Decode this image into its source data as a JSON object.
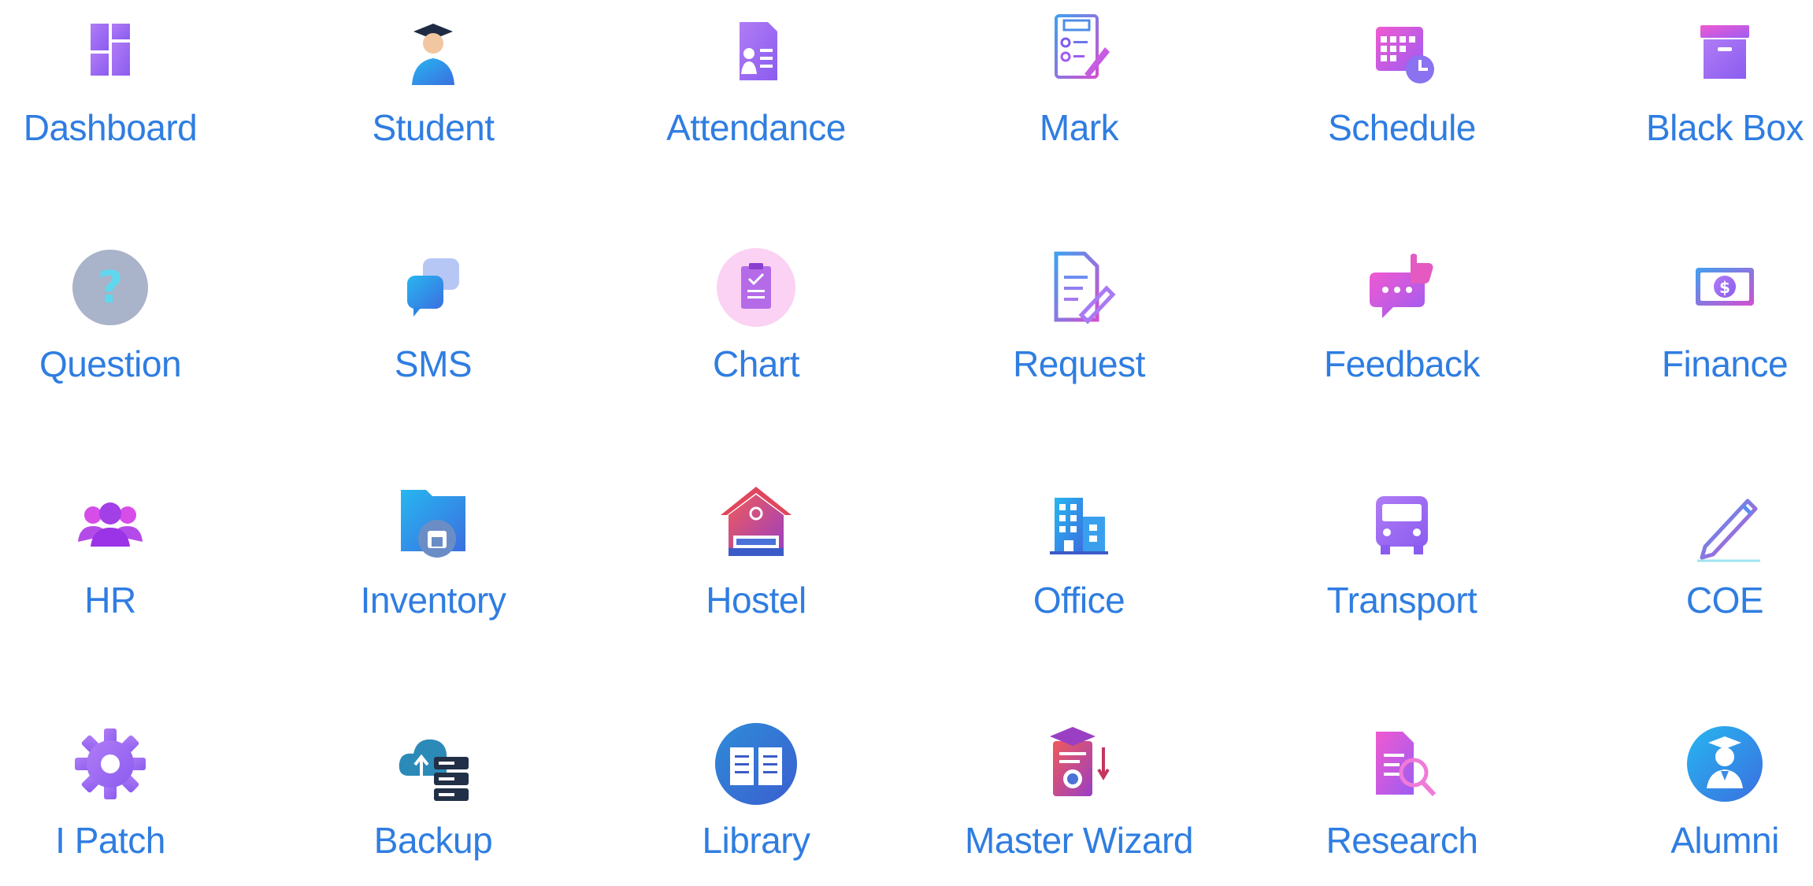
{
  "modules": [
    {
      "label": "Dashboard",
      "icon": "dashboard-icon"
    },
    {
      "label": "Student",
      "icon": "student-icon"
    },
    {
      "label": "Attendance",
      "icon": "attendance-icon"
    },
    {
      "label": "Mark",
      "icon": "mark-icon"
    },
    {
      "label": "Schedule",
      "icon": "schedule-icon"
    },
    {
      "label": "Black Box",
      "icon": "black-box-icon"
    },
    {
      "label": "Question",
      "icon": "question-icon"
    },
    {
      "label": "SMS",
      "icon": "sms-icon"
    },
    {
      "label": "Chart",
      "icon": "chart-icon"
    },
    {
      "label": "Request",
      "icon": "request-icon"
    },
    {
      "label": "Feedback",
      "icon": "feedback-icon"
    },
    {
      "label": "Finance",
      "icon": "finance-icon"
    },
    {
      "label": "HR",
      "icon": "hr-icon"
    },
    {
      "label": "Inventory",
      "icon": "inventory-icon"
    },
    {
      "label": "Hostel",
      "icon": "hostel-icon"
    },
    {
      "label": "Office",
      "icon": "office-icon"
    },
    {
      "label": "Transport",
      "icon": "transport-icon"
    },
    {
      "label": "COE",
      "icon": "coe-icon"
    },
    {
      "label": "I Patch",
      "icon": "gear-icon"
    },
    {
      "label": "Backup",
      "icon": "backup-icon"
    },
    {
      "label": "Library",
      "icon": "library-icon"
    },
    {
      "label": "Master Wizard",
      "icon": "master-wizard-icon"
    },
    {
      "label": "Research",
      "icon": "research-icon"
    },
    {
      "label": "Alumni",
      "icon": "alumni-icon"
    }
  ],
  "colors": {
    "label": "#2f7de1",
    "accent_purple": "#a85cf0",
    "accent_blue": "#3b8be8",
    "accent_pink": "#e24cc0"
  }
}
